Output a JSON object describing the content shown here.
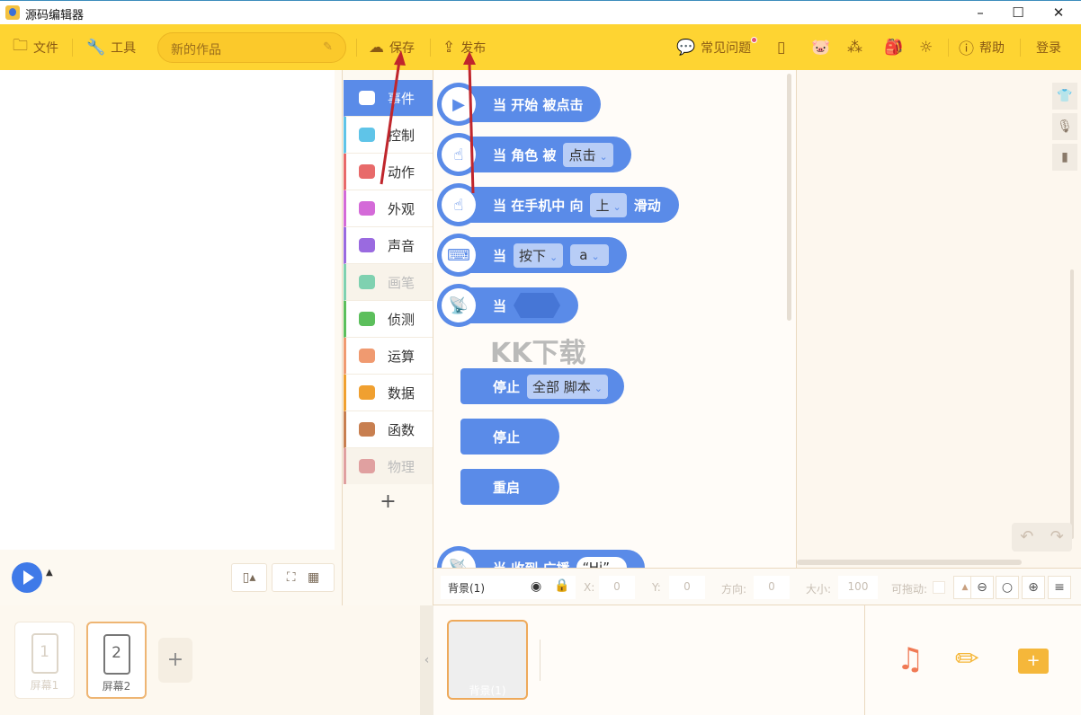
{
  "window": {
    "title": "源码编辑器",
    "min": "–",
    "max": "☐",
    "close": "✕"
  },
  "toolbar": {
    "file": "文件",
    "tools": "工具",
    "project_name": "新的作品",
    "save": "保存",
    "publish": "发布",
    "faq": "常见问题",
    "help": "帮助",
    "login": "登录"
  },
  "categories": [
    {
      "label": "事件",
      "color": "#5a8be8"
    },
    {
      "label": "控制",
      "color": "#5fc4e8"
    },
    {
      "label": "动作",
      "color": "#e86a6a"
    },
    {
      "label": "外观",
      "color": "#d46ad8"
    },
    {
      "label": "声音",
      "color": "#9a6ae0"
    },
    {
      "label": "画笔",
      "color": "#7fd1b0"
    },
    {
      "label": "侦测",
      "color": "#5cbf5c"
    },
    {
      "label": "运算",
      "color": "#f09a70"
    },
    {
      "label": "数据",
      "color": "#f0a030"
    },
    {
      "label": "函数",
      "color": "#c87f50"
    },
    {
      "label": "物理",
      "color": "#e0a0a0"
    }
  ],
  "add_label": "+",
  "blocks": {
    "b1": "当 开始 被点击",
    "b2": "当 角色 被",
    "b2_dd": "点击",
    "b3": "当 在手机中 向",
    "b3_dd": "上",
    "b3_end": "滑动",
    "b4": "当",
    "b4_dd1": "按下",
    "b4_dd2": "a",
    "b5": "当",
    "b6": "停止",
    "b6_dd": "全部 脚本",
    "b7": "停止",
    "b8": "重启",
    "b9": "当 收到 广播",
    "b9_dd": "“Hi”"
  },
  "watermark": "KK下载",
  "props": {
    "name": "背景(1)",
    "x_label": "X:",
    "x": "0",
    "y_label": "Y:",
    "y": "0",
    "dir_label": "方向:",
    "dir": "0",
    "size_label": "大小:",
    "size": "100",
    "drag_label": "可拖动:"
  },
  "screens": [
    {
      "num": "1",
      "label": "屏幕1"
    },
    {
      "num": "2",
      "label": "屏幕2"
    }
  ],
  "background": {
    "label": "背景(1)"
  }
}
